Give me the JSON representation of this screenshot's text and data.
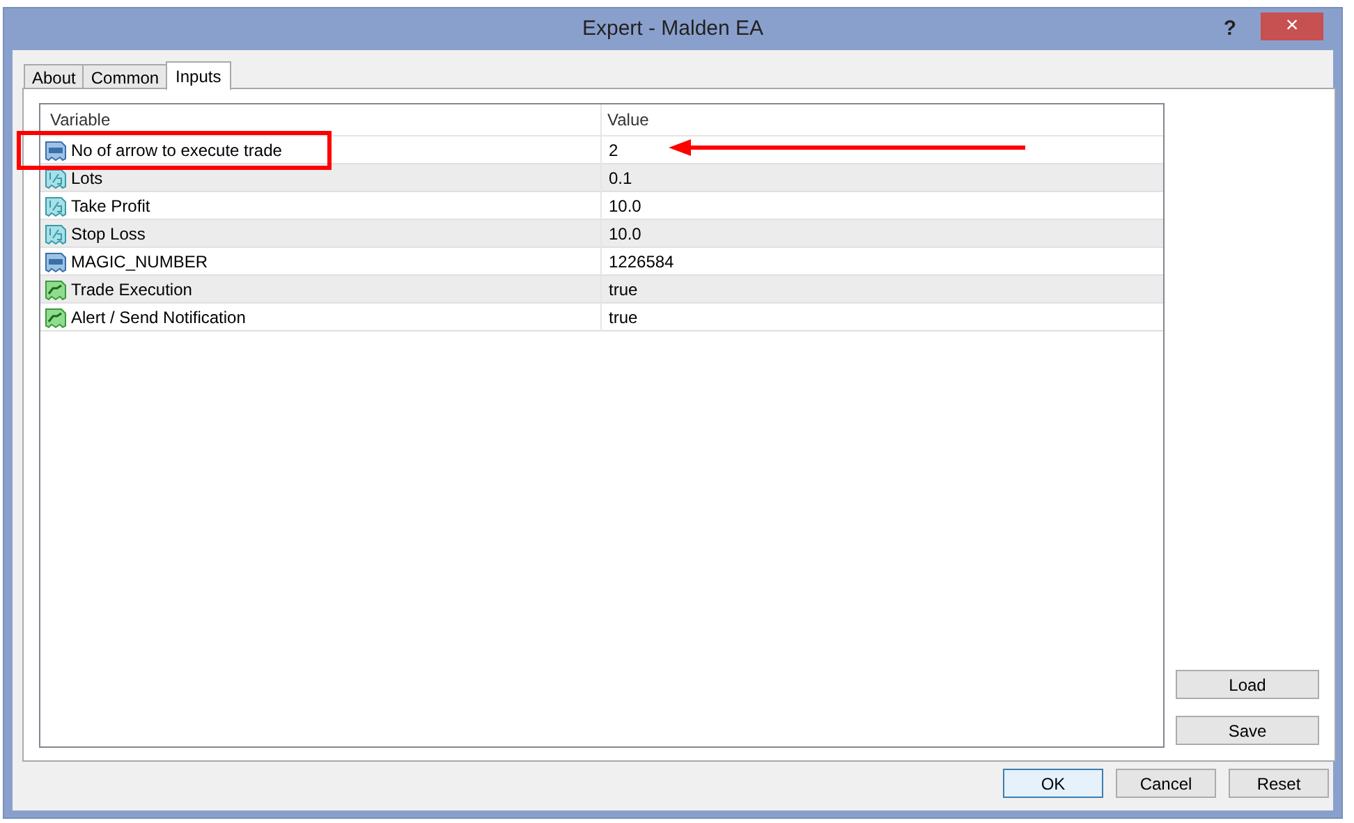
{
  "window": {
    "title": "Expert - Malden EA",
    "help": "?",
    "close": "×"
  },
  "tabs": [
    {
      "label": "About",
      "selected": false
    },
    {
      "label": "Common",
      "selected": false
    },
    {
      "label": "Inputs",
      "selected": true
    }
  ],
  "table": {
    "columns": [
      "Variable",
      "Value"
    ],
    "rows": [
      {
        "kind": "integer",
        "variable": "No of arrow to execute trade",
        "value": "2"
      },
      {
        "kind": "double",
        "variable": "Lots",
        "value": "0.1"
      },
      {
        "kind": "double",
        "variable": "Take Profit",
        "value": "10.0"
      },
      {
        "kind": "double",
        "variable": "Stop Loss",
        "value": "10.0"
      },
      {
        "kind": "integer",
        "variable": "MAGIC_NUMBER",
        "value": "1226584"
      },
      {
        "kind": "boolean",
        "variable": "Trade Execution",
        "value": "true"
      },
      {
        "kind": "boolean",
        "variable": "Alert / Send Notification",
        "value": "true"
      }
    ]
  },
  "side_buttons": [
    "Load",
    "Save"
  ],
  "buttons": [
    {
      "label": "OK",
      "default": true
    },
    {
      "label": "Cancel",
      "default": false
    },
    {
      "label": "Reset",
      "default": false
    }
  ]
}
